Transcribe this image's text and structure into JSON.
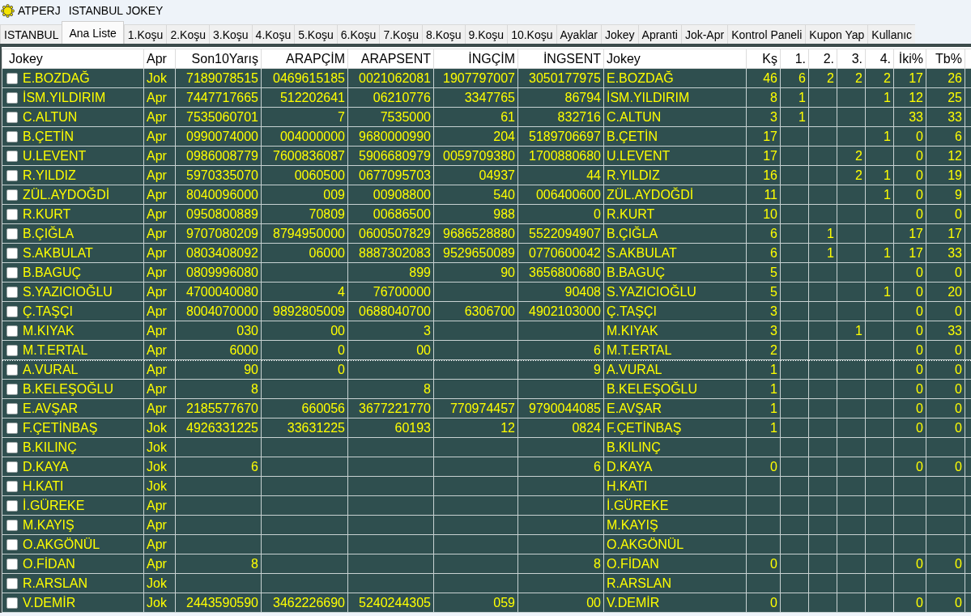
{
  "window": {
    "app_name": "ATPERJ",
    "title": "ISTANBUL JOKEY"
  },
  "tabs": [
    {
      "label": "ISTANBUL",
      "selected": false
    },
    {
      "label": "Ana Liste",
      "selected": true
    },
    {
      "label": "1.Koşu",
      "selected": false
    },
    {
      "label": "2.Koşu",
      "selected": false
    },
    {
      "label": "3.Koşu",
      "selected": false
    },
    {
      "label": "4.Koşu",
      "selected": false
    },
    {
      "label": "5.Koşu",
      "selected": false
    },
    {
      "label": "6.Koşu",
      "selected": false
    },
    {
      "label": "7.Koşu",
      "selected": false
    },
    {
      "label": "8.Koşu",
      "selected": false
    },
    {
      "label": "9.Koşu",
      "selected": false
    },
    {
      "label": "10.Koşu",
      "selected": false
    },
    {
      "label": "Ayaklar",
      "selected": false
    },
    {
      "label": "Jokey",
      "selected": false
    },
    {
      "label": "Apranti",
      "selected": false
    },
    {
      "label": "Jok-Apr",
      "selected": false
    },
    {
      "label": "Kontrol Paneli",
      "selected": false
    },
    {
      "label": "Kupon Yap",
      "selected": false
    },
    {
      "label": "Kullanıc",
      "selected": false
    }
  ],
  "table": {
    "columns": [
      {
        "label": "Jokey",
        "kind": "name"
      },
      {
        "label": "Apr",
        "kind": "text"
      },
      {
        "label": "Son10Yarış",
        "kind": "number"
      },
      {
        "label": "ARAPÇİM",
        "kind": "number"
      },
      {
        "label": "ARAPSENT",
        "kind": "number"
      },
      {
        "label": "İNGÇİM",
        "kind": "number"
      },
      {
        "label": "İNGSENT",
        "kind": "number"
      },
      {
        "label": "Jokey",
        "kind": "text"
      },
      {
        "label": "Kş",
        "kind": "number"
      },
      {
        "label": "1.",
        "kind": "number"
      },
      {
        "label": "2.",
        "kind": "number"
      },
      {
        "label": "3.",
        "kind": "number"
      },
      {
        "label": "4.",
        "kind": "number"
      },
      {
        "label": "İki%",
        "kind": "number"
      },
      {
        "label": "Tb%",
        "kind": "number"
      }
    ],
    "rows": [
      {
        "checked": false,
        "focused": false,
        "cells": [
          "E.BOZDAĞ",
          "Jok",
          "7189078515",
          "0469615185",
          "0021062081",
          "1907797007",
          "3050177975",
          "E.BOZDAĞ",
          "46",
          "6",
          "2",
          "2",
          "2",
          "17",
          "26"
        ]
      },
      {
        "checked": false,
        "focused": false,
        "cells": [
          "İSM.YILDIRIM",
          "Apr",
          "7447717665",
          "512202641",
          "06210776",
          "3347765",
          "86794",
          "İSM.YILDIRIM",
          "8",
          "1",
          null,
          null,
          "1",
          "12",
          "25"
        ]
      },
      {
        "checked": false,
        "focused": false,
        "cells": [
          "C.ALTUN",
          "Apr",
          "7535060701",
          "7",
          "7535000",
          "61",
          "832716",
          "C.ALTUN",
          "3",
          "1",
          null,
          null,
          null,
          "33",
          "33"
        ]
      },
      {
        "checked": false,
        "focused": false,
        "cells": [
          "B.ÇETİN",
          "Apr",
          "0990074000",
          "004000000",
          "9680000990",
          "204",
          "5189706697",
          "B.ÇETİN",
          "17",
          null,
          null,
          null,
          "1",
          "0",
          "6"
        ]
      },
      {
        "checked": false,
        "focused": false,
        "cells": [
          "U.LEVENT",
          "Apr",
          "0986008779",
          "7600836087",
          "5906680979",
          "0059709380",
          "1700880680",
          "U.LEVENT",
          "17",
          null,
          null,
          "2",
          null,
          "0",
          "12"
        ]
      },
      {
        "checked": false,
        "focused": false,
        "cells": [
          "R.YILDIZ",
          "Apr",
          "5970335070",
          "0060500",
          "0677095703",
          "04937",
          "44",
          "R.YILDIZ",
          "16",
          null,
          null,
          "2",
          "1",
          "0",
          "19"
        ]
      },
      {
        "checked": false,
        "focused": false,
        "cells": [
          "ZÜL.AYDOĞDİ",
          "Apr",
          "8040096000",
          "009",
          "00908800",
          "540",
          "006400600",
          "ZÜL.AYDOĞDİ",
          "11",
          null,
          null,
          null,
          "1",
          "0",
          "9"
        ]
      },
      {
        "checked": false,
        "focused": false,
        "cells": [
          "R.KURT",
          "Apr",
          "0950800889",
          "70809",
          "00686500",
          "988",
          "0",
          "R.KURT",
          "10",
          null,
          null,
          null,
          null,
          "0",
          "0"
        ]
      },
      {
        "checked": false,
        "focused": false,
        "cells": [
          "B.ÇIĞLA",
          "Apr",
          "9707080209",
          "8794950000",
          "0600507829",
          "9686528880",
          "5522094907",
          "B.ÇIĞLA",
          "6",
          null,
          "1",
          null,
          null,
          "17",
          "17"
        ]
      },
      {
        "checked": false,
        "focused": false,
        "cells": [
          "S.AKBULAT",
          "Apr",
          "0803408092",
          "06000",
          "8887302083",
          "9529650089",
          "0770600042",
          "S.AKBULAT",
          "6",
          null,
          "1",
          null,
          "1",
          "17",
          "33"
        ]
      },
      {
        "checked": false,
        "focused": false,
        "cells": [
          "B.BAGUÇ",
          "Apr",
          "0809996080",
          null,
          "899",
          "90",
          "3656800680",
          "B.BAGUÇ",
          "5",
          null,
          null,
          null,
          null,
          "0",
          "0"
        ]
      },
      {
        "checked": false,
        "focused": false,
        "cells": [
          "S.YAZICIOĞLU",
          "Apr",
          "4700040080",
          "4",
          "76700000",
          null,
          "90408",
          "S.YAZICIOĞLU",
          "5",
          null,
          null,
          null,
          "1",
          "0",
          "20"
        ]
      },
      {
        "checked": false,
        "focused": false,
        "cells": [
          "Ç.TAŞÇI",
          "Apr",
          "8004070000",
          "9892805009",
          "0688040700",
          "6306700",
          "4902103000",
          "Ç.TAŞÇI",
          "3",
          null,
          null,
          null,
          null,
          "0",
          "0"
        ]
      },
      {
        "checked": false,
        "focused": false,
        "cells": [
          "M.KIYAK",
          "Apr",
          "030",
          "00",
          "3",
          null,
          null,
          "M.KIYAK",
          "3",
          null,
          null,
          "1",
          null,
          "0",
          "33"
        ]
      },
      {
        "checked": false,
        "focused": false,
        "cells": [
          "M.T.ERTAL",
          "Apr",
          "6000",
          "0",
          "00",
          null,
          "6",
          "M.T.ERTAL",
          "2",
          null,
          null,
          null,
          null,
          "0",
          "0"
        ]
      },
      {
        "checked": false,
        "focused": true,
        "cells": [
          "A.VURAL",
          "Apr",
          "90",
          "0",
          null,
          null,
          "9",
          "A.VURAL",
          "1",
          null,
          null,
          null,
          null,
          "0",
          "0"
        ]
      },
      {
        "checked": false,
        "focused": false,
        "cells": [
          "B.KELEŞOĞLU",
          "Apr",
          "8",
          null,
          "8",
          null,
          null,
          "B.KELEŞOĞLU",
          "1",
          null,
          null,
          null,
          null,
          "0",
          "0"
        ]
      },
      {
        "checked": false,
        "focused": false,
        "cells": [
          "E.AVŞAR",
          "Apr",
          "2185577670",
          "660056",
          "3677221770",
          "770974457",
          "9790044085",
          "E.AVŞAR",
          "1",
          null,
          null,
          null,
          null,
          "0",
          "0"
        ]
      },
      {
        "checked": false,
        "focused": false,
        "cells": [
          "F.ÇETİNBAŞ",
          "Jok",
          "4926331225",
          "33631225",
          "60193",
          "12",
          "0824",
          "F.ÇETİNBAŞ",
          "1",
          null,
          null,
          null,
          null,
          "0",
          "0"
        ]
      },
      {
        "checked": false,
        "focused": false,
        "cells": [
          "B.KILINÇ",
          "Jok",
          null,
          null,
          null,
          null,
          null,
          "B.KILINÇ",
          null,
          null,
          null,
          null,
          null,
          null,
          null
        ]
      },
      {
        "checked": false,
        "focused": false,
        "cells": [
          "D.KAYA",
          "Jok",
          "6",
          null,
          null,
          null,
          "6",
          "D.KAYA",
          "0",
          null,
          null,
          null,
          null,
          "0",
          "0"
        ]
      },
      {
        "checked": false,
        "focused": false,
        "cells": [
          "H.KATI",
          "Jok",
          null,
          null,
          null,
          null,
          null,
          "H.KATI",
          null,
          null,
          null,
          null,
          null,
          null,
          null
        ]
      },
      {
        "checked": false,
        "focused": false,
        "cells": [
          "İ.GÜREKE",
          "Apr",
          null,
          null,
          null,
          null,
          null,
          "İ.GÜREKE",
          null,
          null,
          null,
          null,
          null,
          null,
          null
        ]
      },
      {
        "checked": false,
        "focused": false,
        "cells": [
          "M.KAYIŞ",
          "Apr",
          null,
          null,
          null,
          null,
          null,
          "M.KAYIŞ",
          null,
          null,
          null,
          null,
          null,
          null,
          null
        ]
      },
      {
        "checked": false,
        "focused": false,
        "cells": [
          "O.AKGÖNÜL",
          "Apr",
          null,
          null,
          null,
          null,
          null,
          "O.AKGÖNÜL",
          null,
          null,
          null,
          null,
          null,
          null,
          null
        ]
      },
      {
        "checked": false,
        "focused": false,
        "cells": [
          "O.FİDAN",
          "Apr",
          "8",
          null,
          null,
          null,
          "8",
          "O.FİDAN",
          "0",
          null,
          null,
          null,
          null,
          "0",
          "0"
        ]
      },
      {
        "checked": false,
        "focused": false,
        "cells": [
          "R.ARSLAN",
          "Jok",
          null,
          null,
          null,
          null,
          null,
          "R.ARSLAN",
          null,
          null,
          null,
          null,
          null,
          null,
          null
        ]
      },
      {
        "checked": false,
        "focused": false,
        "cells": [
          "V.DEMİR",
          "Jok",
          "2443590590",
          "3462226690",
          "5240244305",
          "059",
          "00",
          "V.DEMİR",
          "0",
          null,
          null,
          null,
          null,
          "0",
          "0"
        ]
      }
    ]
  }
}
